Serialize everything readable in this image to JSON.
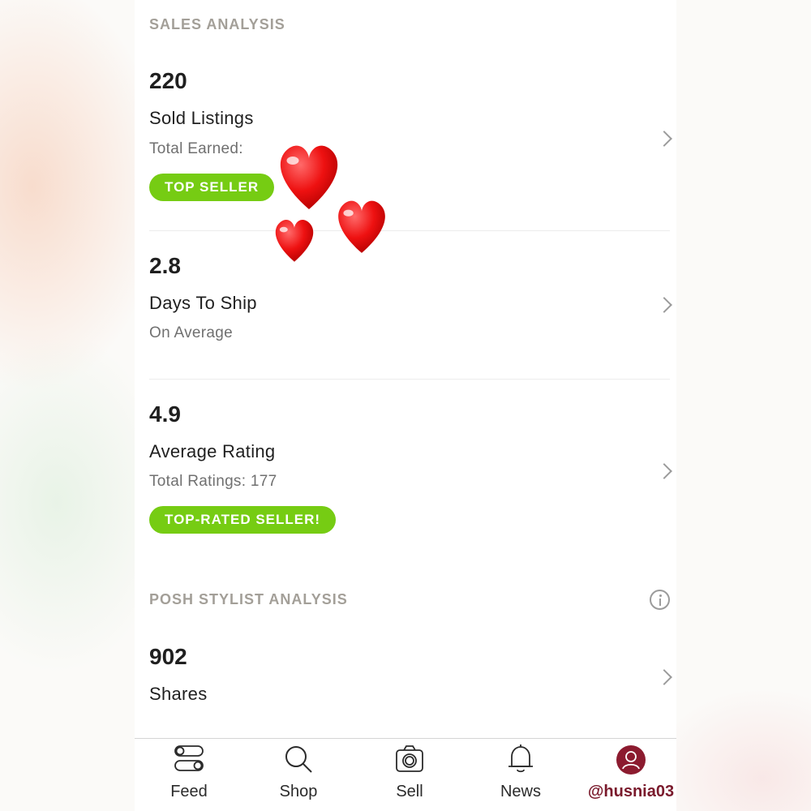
{
  "sales_analysis": {
    "header": "SALES ANALYSIS",
    "rows": [
      {
        "value": "220",
        "title": "Sold Listings",
        "subtitle": "Total Earned:",
        "badge": "TOP SELLER"
      },
      {
        "value": "2.8",
        "title": "Days To Ship",
        "subtitle": "On Average"
      },
      {
        "value": "4.9",
        "title": "Average Rating",
        "subtitle": "Total Ratings: 177",
        "badge": "TOP-RATED SELLER!"
      }
    ]
  },
  "posh_stylist_analysis": {
    "header": "POSH STYLIST ANALYSIS",
    "rows": [
      {
        "value": "902",
        "title": "Shares"
      }
    ]
  },
  "tabbar": {
    "tabs": [
      {
        "label": "Feed",
        "icon": "feed-icon"
      },
      {
        "label": "Shop",
        "icon": "search-icon"
      },
      {
        "label": "Sell",
        "icon": "camera-icon"
      },
      {
        "label": "News",
        "icon": "bell-icon"
      },
      {
        "label": "@husnia03",
        "icon": "profile-avatar",
        "active": true
      }
    ]
  },
  "colors": {
    "badge_green": "#76cc13",
    "active_tab": "#7a1a2c",
    "header_gray": "#a39f98",
    "heart_red": "#ee1111"
  },
  "stickers": [
    "heart-sticker",
    "heart-sticker",
    "heart-sticker"
  ]
}
